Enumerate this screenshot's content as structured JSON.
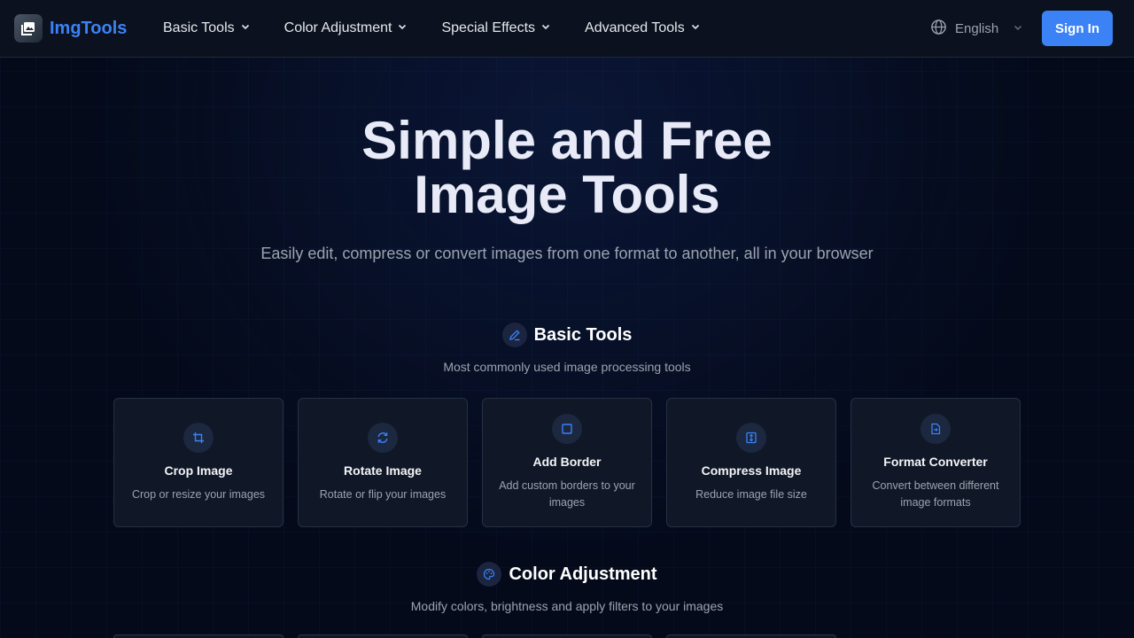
{
  "brand": {
    "name": "ImgTools"
  },
  "nav": [
    {
      "label": "Basic Tools"
    },
    {
      "label": "Color Adjustment"
    },
    {
      "label": "Special Effects"
    },
    {
      "label": "Advanced Tools"
    }
  ],
  "language": {
    "label": "English"
  },
  "signin_label": "Sign In",
  "hero": {
    "title_line1": "Simple and Free",
    "title_line2": "Image Tools",
    "subtitle": "Easily edit, compress or convert images from one format to another, all in your browser"
  },
  "sections": [
    {
      "title": "Basic Tools",
      "desc": "Most commonly used image processing tools",
      "icon": "pencil-icon",
      "cards": [
        {
          "title": "Crop Image",
          "desc": "Crop or resize your images",
          "icon": "crop-icon"
        },
        {
          "title": "Rotate Image",
          "desc": "Rotate or flip your images",
          "icon": "rotate-icon"
        },
        {
          "title": "Add Border",
          "desc": "Add custom borders to your images",
          "icon": "border-icon"
        },
        {
          "title": "Compress Image",
          "desc": "Reduce image file size",
          "icon": "compress-icon"
        },
        {
          "title": "Format Converter",
          "desc": "Convert between different image formats",
          "icon": "file-convert-icon"
        }
      ]
    },
    {
      "title": "Color Adjustment",
      "desc": "Modify colors, brightness and apply filters to your images",
      "icon": "palette-icon"
    }
  ],
  "colors": {
    "accent": "#3b82f6",
    "background": "#040a1a",
    "card": "#101827"
  }
}
